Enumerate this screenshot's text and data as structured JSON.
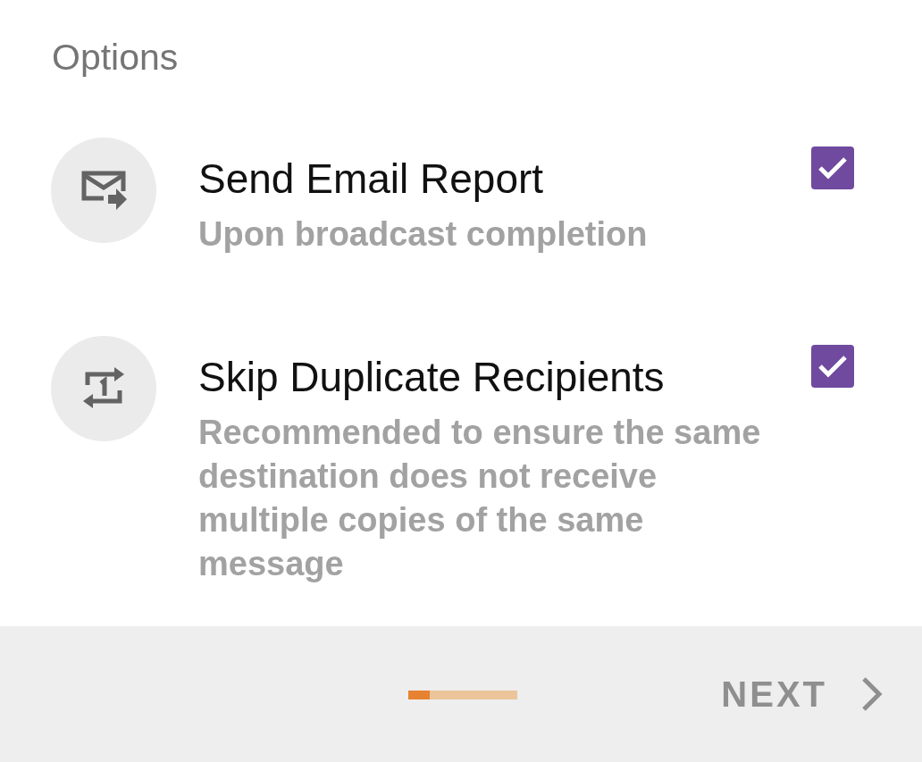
{
  "title": "Options",
  "options": [
    {
      "kind": "mail",
      "title": "Send Email Report",
      "subtitle": "Upon broadcast completion",
      "checked": true
    },
    {
      "kind": "repeat",
      "title": "Skip Duplicate Recipients",
      "subtitle": "Recommended to ensure the same destination does not receive multiple copies of the same message",
      "checked": true
    }
  ],
  "footer": {
    "progress": {
      "level": 0.2
    },
    "next": "NEXT"
  }
}
